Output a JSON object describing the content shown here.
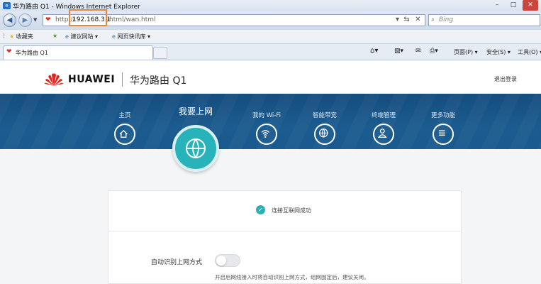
{
  "window": {
    "title": "华为路由 Q1 - Windows Internet Explorer",
    "controls": [
      "–",
      "□",
      "✕"
    ]
  },
  "address_bar": {
    "protocol": "http://",
    "host": "192.168.3.1",
    "path": "/html/wan.html",
    "search_placeholder": "Bing"
  },
  "favorites_bar": {
    "favorites_label": "收藏夹",
    "items": [
      "建议网站 ▾",
      "网页快讯库 ▾"
    ]
  },
  "tabs": {
    "active_label": "华为路由 Q1"
  },
  "command_bar": {
    "page_label": "页面(P) ▾",
    "safety_label": "安全(S) ▾",
    "tools_label": "工具(O) ▾"
  },
  "header": {
    "brand": "HUAWEI",
    "product": "华为路由 Q1",
    "logout": "退出登录"
  },
  "nav": {
    "items": [
      {
        "label": "主页",
        "icon": "home-icon"
      },
      {
        "label": "我要上网",
        "icon": "globe-icon"
      },
      {
        "label": "我的 Wi-Fi",
        "icon": "wifi-icon"
      },
      {
        "label": "智能带宽",
        "icon": "bandwidth-icon"
      },
      {
        "label": "终端管理",
        "icon": "user-icon"
      },
      {
        "label": "更多功能",
        "icon": "menu-icon"
      }
    ]
  },
  "content": {
    "status": "连接互联网成功",
    "auto_detect_label": "自动识别上网方式",
    "auto_detect_enabled": false,
    "hint": "开启后网线接入时将自动识别上网方式，组网固定后，建议关闭。"
  },
  "colors": {
    "nav_bg": "#1c5b8f",
    "accent": "#27b3b9",
    "url_highlight": "#e58a3d",
    "brand_red": "#e1251b"
  }
}
